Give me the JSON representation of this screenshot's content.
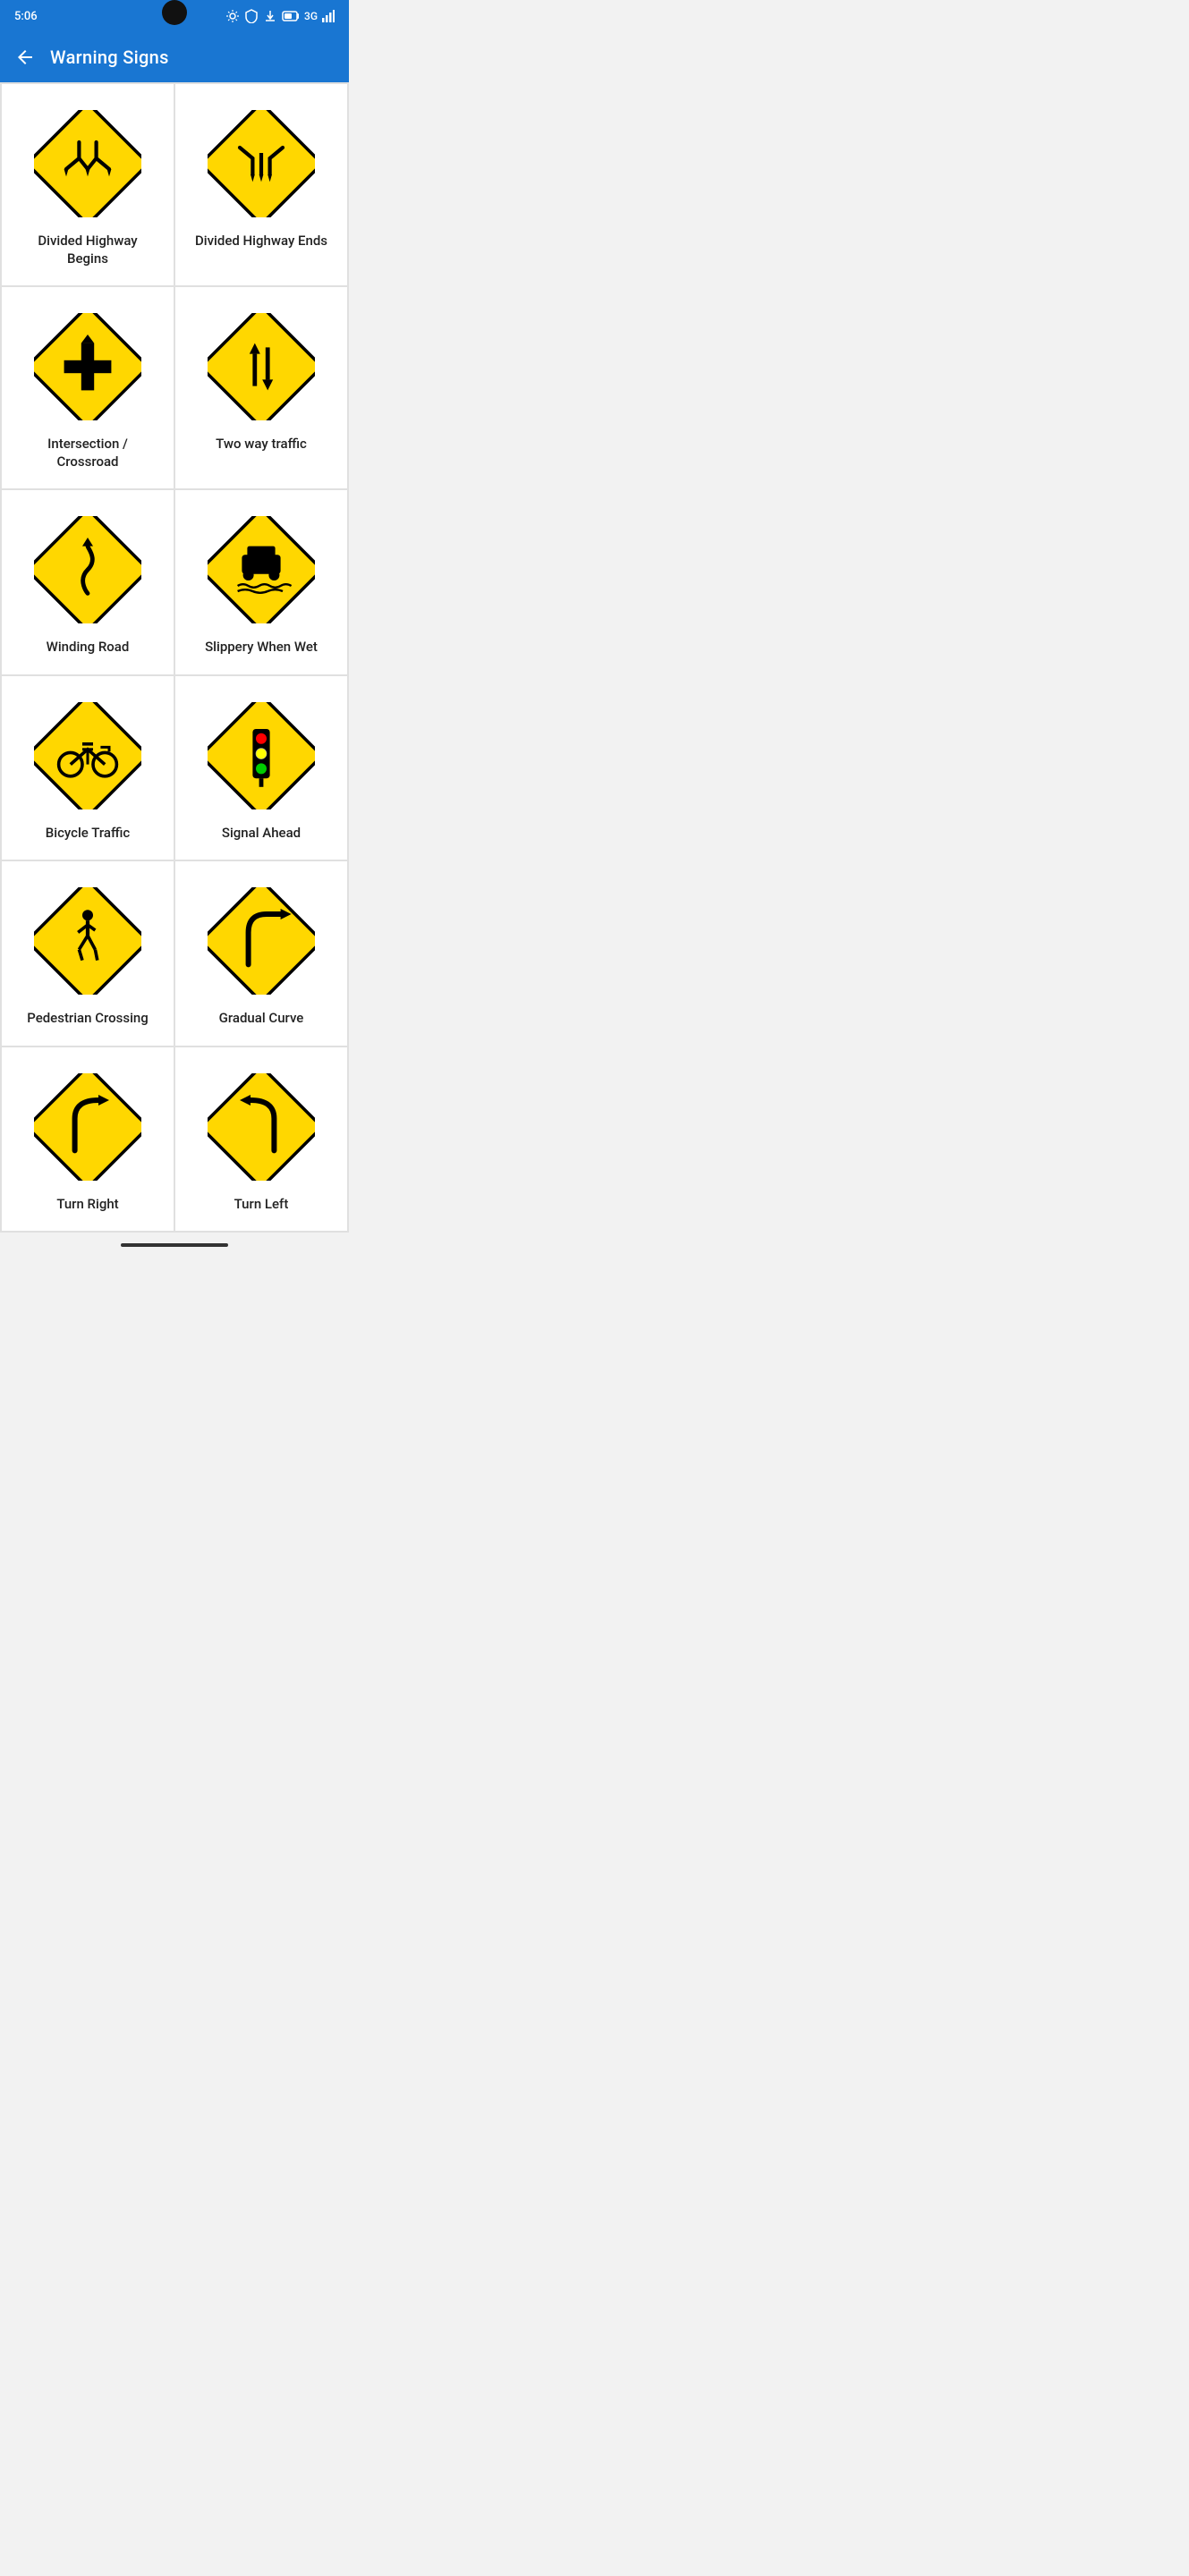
{
  "statusBar": {
    "time": "5:06",
    "network": "3G",
    "icons": [
      "settings",
      "shield",
      "download",
      "battery"
    ]
  },
  "header": {
    "title": "Warning Signs",
    "backLabel": "back"
  },
  "signs": [
    {
      "id": "divided-highway-begins",
      "label": "Divided Highway Begins",
      "type": "divided-highway-begins"
    },
    {
      "id": "divided-highway-ends",
      "label": "Divided Highway Ends",
      "type": "divided-highway-ends"
    },
    {
      "id": "intersection-crossroad",
      "label": "Intersection / Crossroad",
      "type": "intersection-crossroad"
    },
    {
      "id": "two-way-traffic",
      "label": "Two way traffic",
      "type": "two-way-traffic"
    },
    {
      "id": "winding-road",
      "label": "Winding Road",
      "type": "winding-road"
    },
    {
      "id": "slippery-when-wet",
      "label": "Slippery When Wet",
      "type": "slippery-when-wet"
    },
    {
      "id": "bicycle-traffic",
      "label": "Bicycle Traffic",
      "type": "bicycle-traffic"
    },
    {
      "id": "signal-ahead",
      "label": "Signal Ahead",
      "type": "signal-ahead"
    },
    {
      "id": "pedestrian-crossing",
      "label": "Pedestrian Crossing",
      "type": "pedestrian-crossing"
    },
    {
      "id": "gradual-curve",
      "label": "Gradual Curve",
      "type": "gradual-curve"
    },
    {
      "id": "turn-right",
      "label": "Turn Right",
      "type": "turn-right"
    },
    {
      "id": "turn-left",
      "label": "Turn Left",
      "type": "turn-left"
    }
  ]
}
